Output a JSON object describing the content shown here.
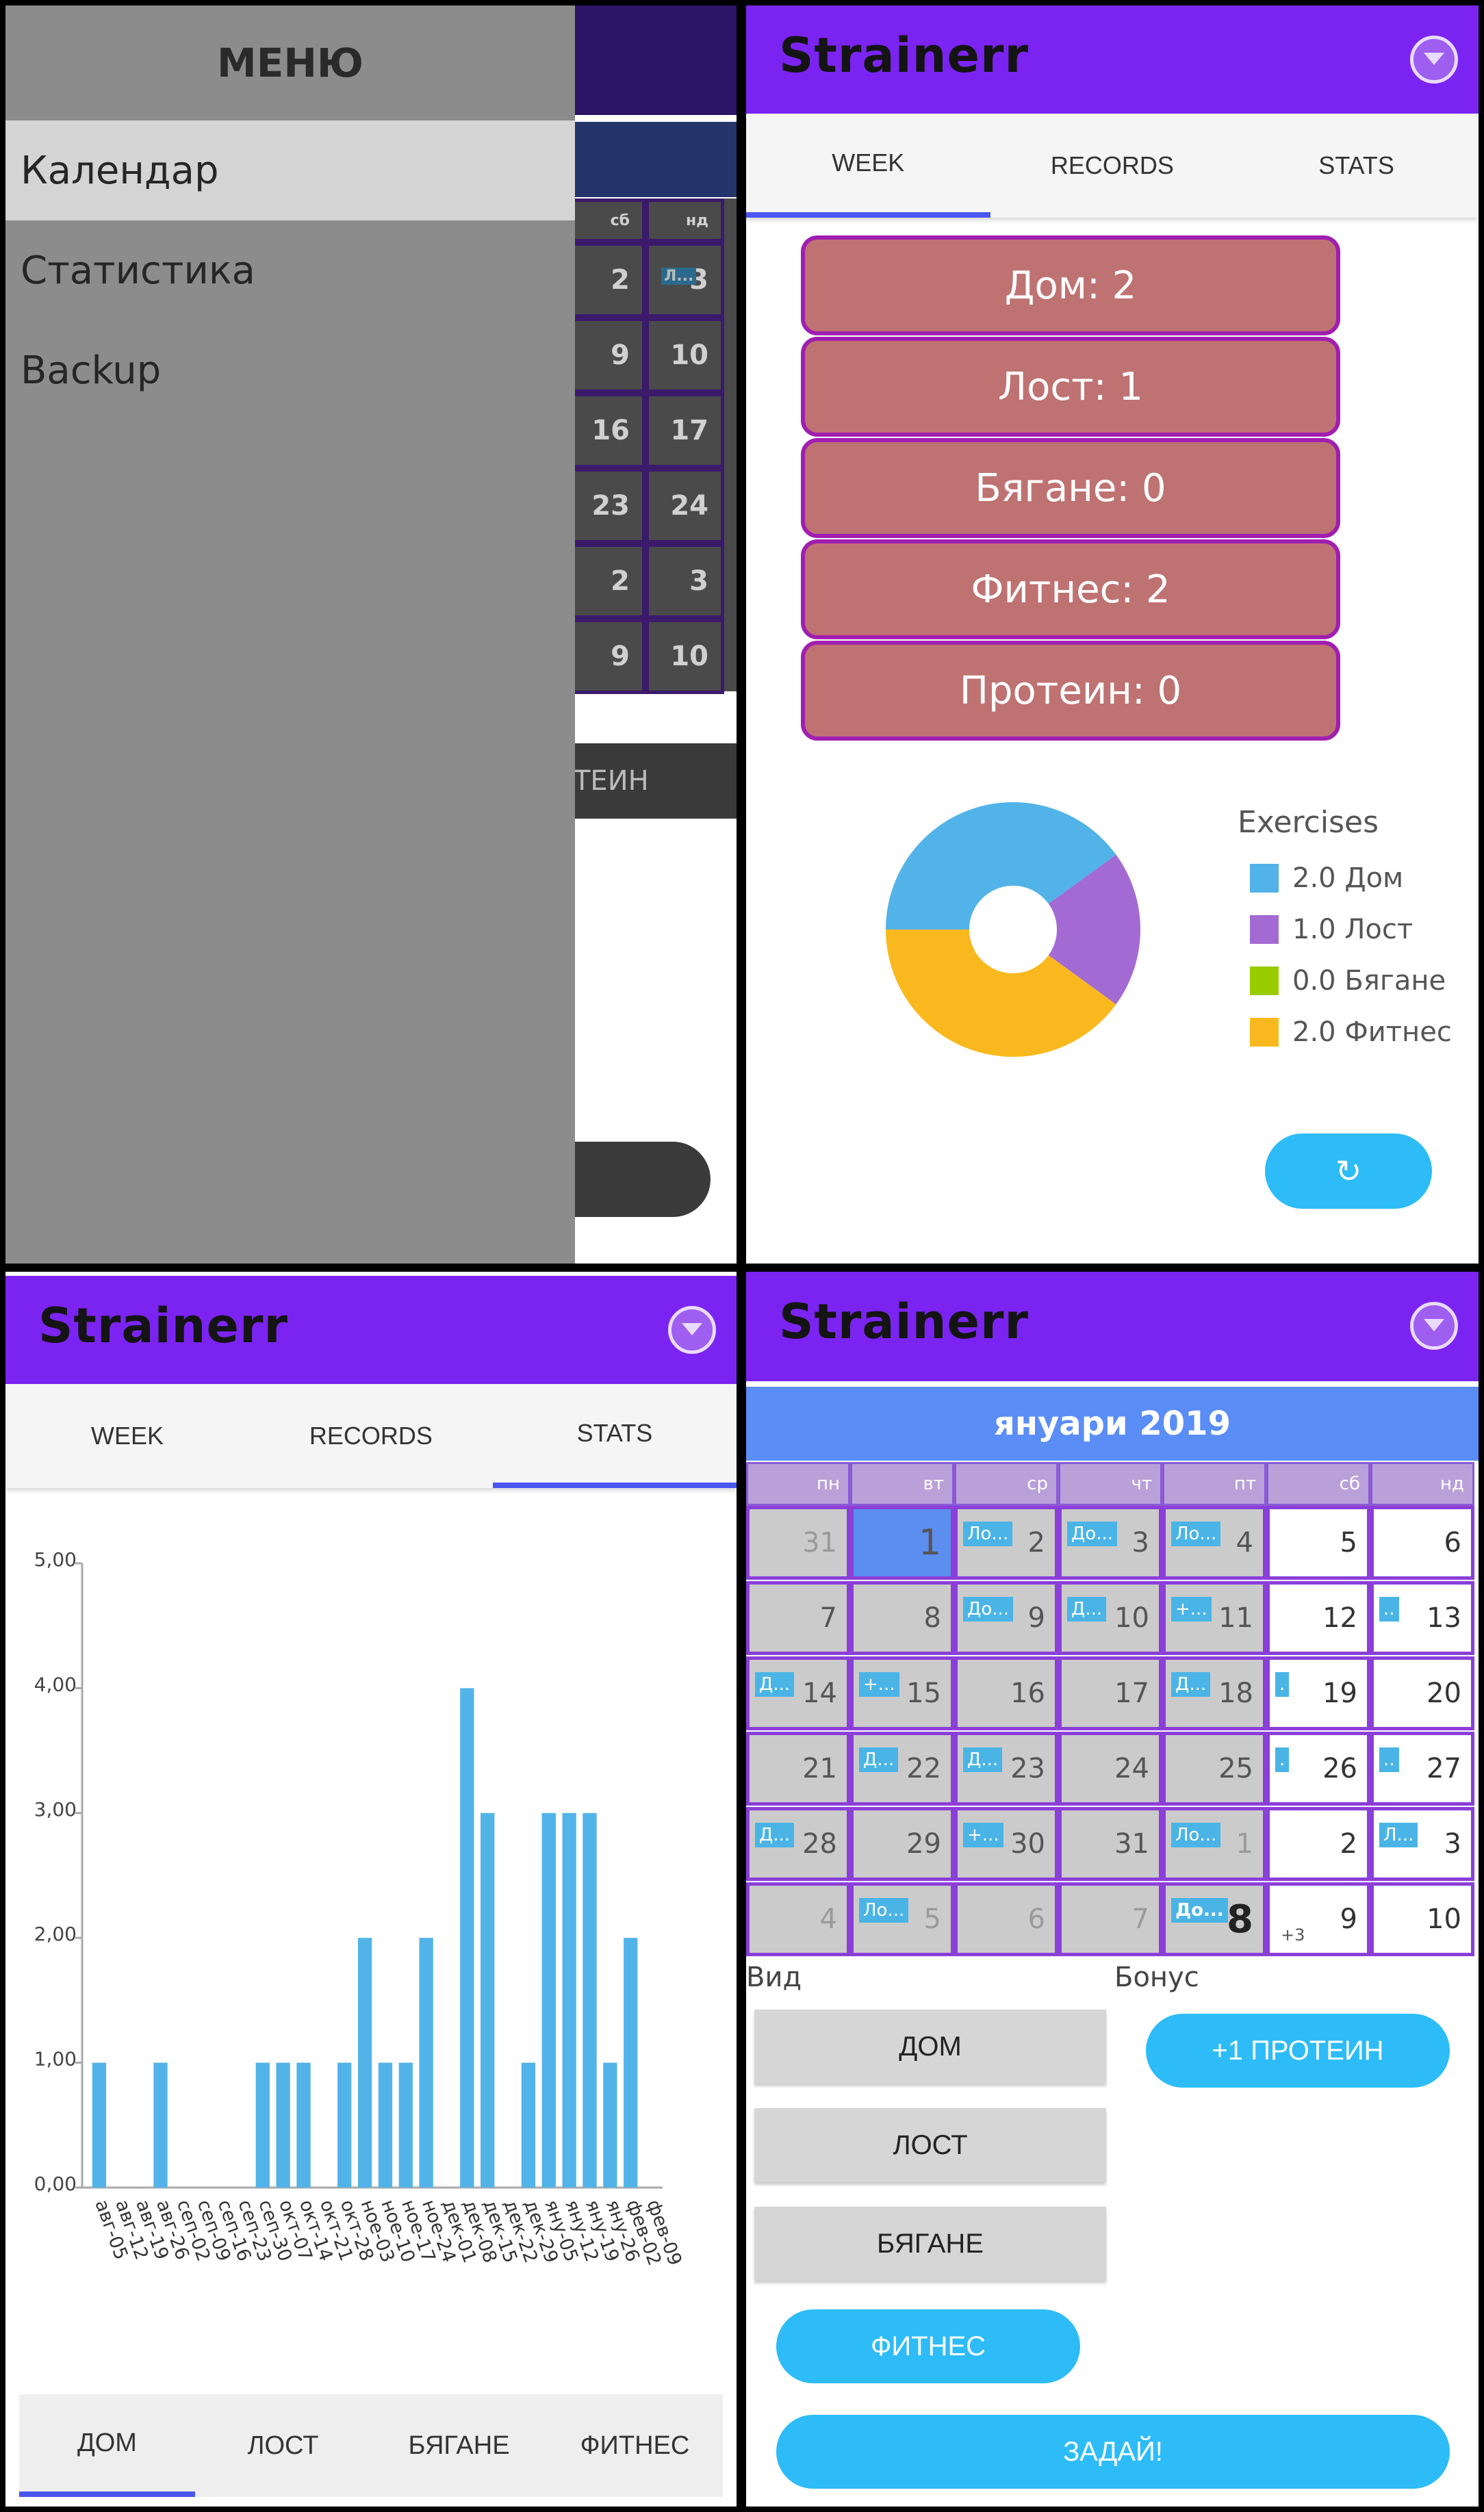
{
  "app": {
    "title": "Strainerr"
  },
  "menu": {
    "title": "МЕНЮ",
    "items": [
      "Календар",
      "Статистика",
      "Backup"
    ],
    "background_cells": [
      [
        "2",
        "3"
      ],
      [
        "9",
        "10"
      ],
      [
        "16",
        "17"
      ],
      [
        "23",
        "24"
      ],
      [
        "2",
        "3"
      ],
      [
        "9",
        "10"
      ]
    ],
    "background_header": [
      "сб",
      "нд"
    ],
    "background_event": "Л...",
    "background_button": "ТЕИН"
  },
  "tabs": [
    "WEEK",
    "RECORDS",
    "STATS"
  ],
  "week": {
    "stats": [
      "Дом: 2",
      "Лост: 1",
      "Бягане: 0",
      "Фитнес: 2",
      "Протеин: 0"
    ],
    "refresh_icon": "↻",
    "legend": {
      "title": "Exercises",
      "items": [
        {
          "label": "2.0 Дом",
          "color": "#52b3e8",
          "value": 2
        },
        {
          "label": "1.0 Лост",
          "color": "#a46ad4",
          "value": 1
        },
        {
          "label": "0.0 Бягане",
          "color": "#99cc00",
          "value": 0
        },
        {
          "label": "2.0 Фитнес",
          "color": "#f9b91e",
          "value": 2
        }
      ]
    }
  },
  "chart_data": {
    "type": "bar",
    "categories": [
      "авг-05",
      "авг-12",
      "авг-19",
      "авг-26",
      "сеп-02",
      "сеп-09",
      "сеп-16",
      "сеп-23",
      "сеп-30",
      "окт-07",
      "окт-14",
      "окт-21",
      "окт-28",
      "ное-03",
      "ное-10",
      "ное-17",
      "ное-24",
      "дек-01",
      "дек-08",
      "дек-15",
      "дек-22",
      "дек-29",
      "яну-05",
      "яну-12",
      "яну-19",
      "яну-26",
      "фев-02",
      "фев-09"
    ],
    "values": [
      1,
      0,
      0,
      1,
      0,
      0,
      0,
      0,
      1,
      1,
      1,
      0,
      1,
      2,
      1,
      1,
      2,
      0,
      4,
      3,
      0,
      1,
      3,
      3,
      3,
      1,
      2,
      0
    ],
    "yticks": [
      "0,00",
      "1,00",
      "2,00",
      "3,00",
      "4,00",
      "5,00"
    ],
    "ylim": [
      0,
      5
    ],
    "color": "#52b3e8"
  },
  "bottom_tabs": [
    "ДОМ",
    "ЛОСТ",
    "БЯГАНЕ",
    "ФИТНЕС"
  ],
  "calendar": {
    "month": "януари 2019",
    "weekdays": [
      "пн",
      "вт",
      "ср",
      "чт",
      "пт",
      "сб",
      "нд"
    ],
    "rows": [
      [
        {
          "d": "31",
          "t": "ext"
        },
        {
          "d": "1",
          "t": "today"
        },
        {
          "d": "2",
          "e": "Ло..."
        },
        {
          "d": "3",
          "e": "До..."
        },
        {
          "d": "4",
          "e": "Ло..."
        },
        {
          "d": "5",
          "t": "white"
        },
        {
          "d": "6",
          "t": "white"
        }
      ],
      [
        {
          "d": "7"
        },
        {
          "d": "8"
        },
        {
          "d": "9",
          "e": "До..."
        },
        {
          "d": "10",
          "e": "Д..."
        },
        {
          "d": "11",
          "e": "+..."
        },
        {
          "d": "12",
          "t": "white"
        },
        {
          "d": "13",
          "t": "white",
          "e": ".."
        }
      ],
      [
        {
          "d": "14",
          "e": "Д..."
        },
        {
          "d": "15",
          "e": "+..."
        },
        {
          "d": "16"
        },
        {
          "d": "17"
        },
        {
          "d": "18",
          "e": "Д..."
        },
        {
          "d": "19",
          "t": "white",
          "e": "."
        },
        {
          "d": "20",
          "t": "white"
        }
      ],
      [
        {
          "d": "21"
        },
        {
          "d": "22",
          "e": "Д..."
        },
        {
          "d": "23",
          "e": "Д..."
        },
        {
          "d": "24"
        },
        {
          "d": "25"
        },
        {
          "d": "26",
          "t": "white",
          "e": "."
        },
        {
          "d": "27",
          "t": "white",
          "e": ".."
        }
      ],
      [
        {
          "d": "28",
          "e": "Д..."
        },
        {
          "d": "29"
        },
        {
          "d": "30",
          "e": "+..."
        },
        {
          "d": "31"
        },
        {
          "d": "1",
          "t": "ext",
          "e": "Ло..."
        },
        {
          "d": "2",
          "t": "white"
        },
        {
          "d": "3",
          "t": "white",
          "e": "Л..."
        }
      ],
      [
        {
          "d": "4",
          "t": "ext"
        },
        {
          "d": "5",
          "t": "ext",
          "e": "Ло..."
        },
        {
          "d": "6",
          "t": "ext"
        },
        {
          "d": "7",
          "t": "ext"
        },
        {
          "d": "8",
          "t": "big",
          "e": "До..."
        },
        {
          "d": "9",
          "t": "white",
          "n": "+3"
        },
        {
          "d": "10",
          "t": "white"
        }
      ]
    ],
    "type_label": "Вид",
    "bonus_label": "Бонус",
    "type_buttons": [
      "ДОМ",
      "ЛОСТ",
      "БЯГАНЕ",
      "ФИТНЕС"
    ],
    "bonus_button": "+1 ПРОТЕИН",
    "submit_button": "ЗАДАЙ!"
  }
}
